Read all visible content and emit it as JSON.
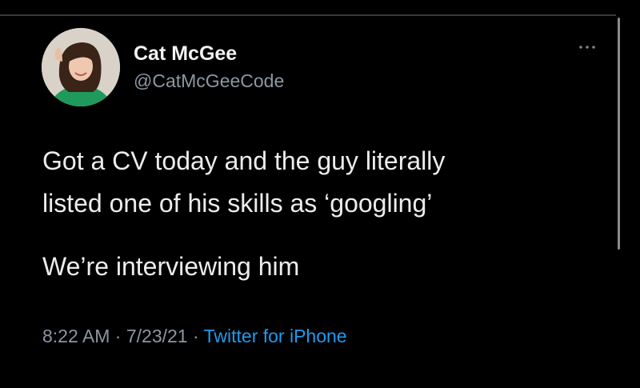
{
  "user": {
    "display_name": "Cat McGee",
    "handle": "@CatMcGeeCode"
  },
  "tweet": {
    "line1": "Got a CV today and the guy literally",
    "line2": "listed one of his skills as ‘googling’",
    "line3": "We’re interviewing him"
  },
  "meta": {
    "time": "8:22 AM",
    "sep1": " · ",
    "date": "7/23/21",
    "sep2": " · ",
    "source": "Twitter for iPhone"
  },
  "icons": {
    "more": "more-horizontal-icon",
    "avatar": "profile-photo"
  },
  "colors": {
    "background": "#000000",
    "text": "#ececec",
    "secondary": "#8b97a3",
    "link": "#1d9bf0"
  }
}
